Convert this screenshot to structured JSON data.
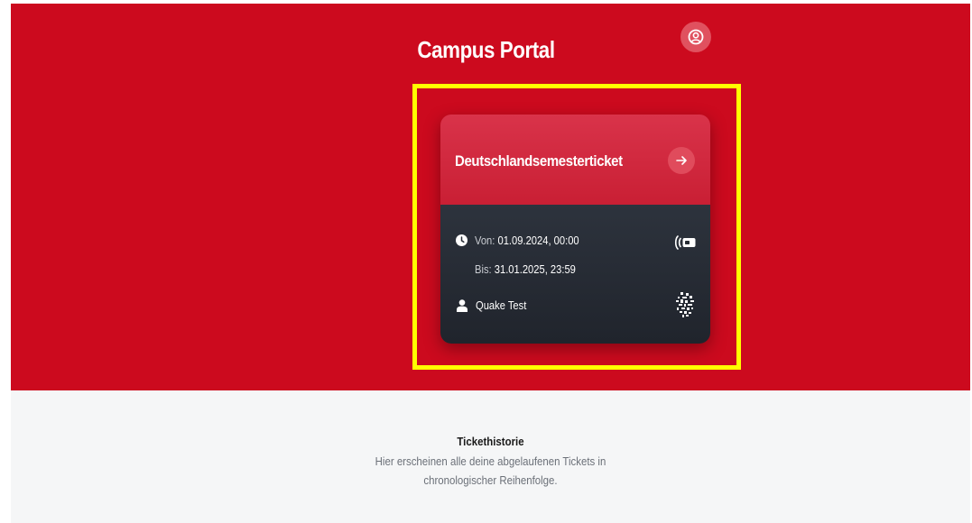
{
  "header": {
    "title": "Campus Portal",
    "profile_icon": "user-circle-icon"
  },
  "ticket": {
    "name": "Deutschlandsemesterticket",
    "open_icon": "arrow-right-icon",
    "valid_from_label": "Von: ",
    "valid_from": "01.09.2024, 00:00",
    "valid_to_label": "Bis: ",
    "valid_to": "31.01.2025, 23:59",
    "holder": "Quake Test",
    "icons": [
      "clock-icon",
      "user-icon",
      "nfc-icon",
      "barcode-icon"
    ]
  },
  "history": {
    "title": "Tickethistorie",
    "description_line1": "Hier erscheinen alle deine abgelaufenen Tickets in",
    "description_line2": "chronologischer Reihenfolge."
  },
  "colors": {
    "brand_red": "#cc0a1e",
    "highlight": "#ffff00",
    "ticket_body": "#262b33"
  }
}
